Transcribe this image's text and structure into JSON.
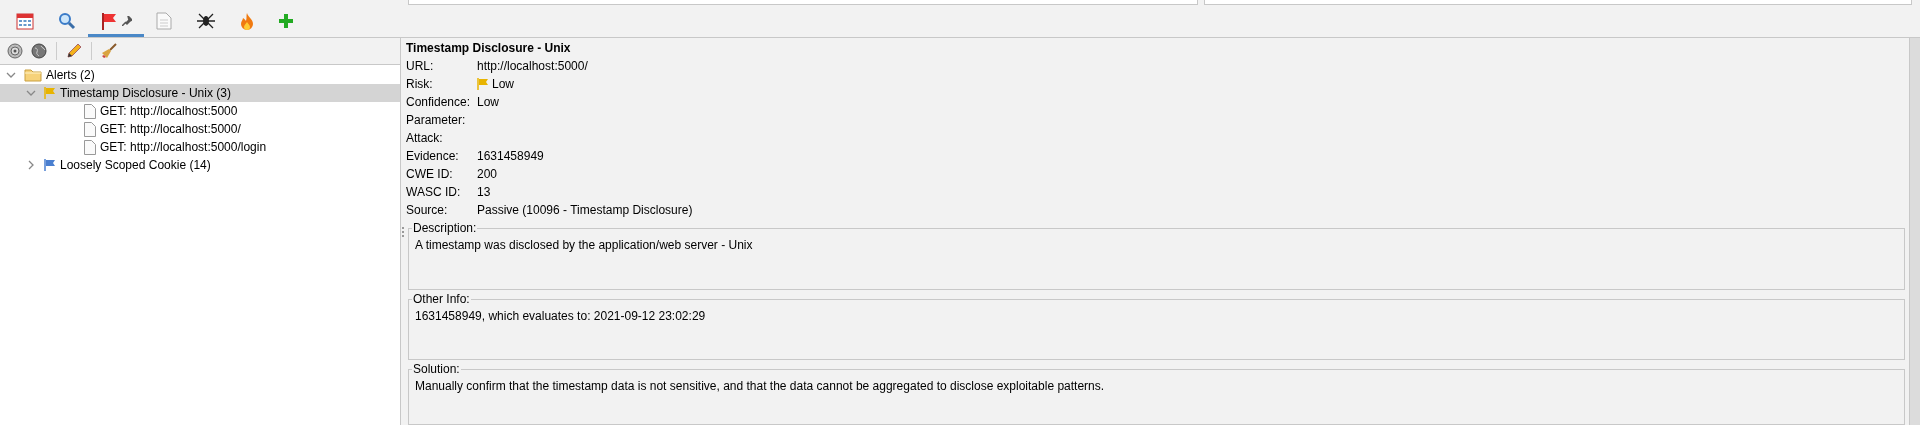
{
  "tabs": [
    {
      "kind": "calendar",
      "selected": false
    },
    {
      "kind": "search",
      "selected": false
    },
    {
      "kind": "alerts",
      "selected": true
    },
    {
      "kind": "document",
      "selected": false
    },
    {
      "kind": "spider",
      "selected": false
    },
    {
      "kind": "fire",
      "selected": false
    },
    {
      "kind": "add",
      "selected": false
    }
  ],
  "toolbar": [
    {
      "kind": "target"
    },
    {
      "kind": "globe"
    },
    {
      "kind": "pencil"
    },
    {
      "kind": "broom"
    }
  ],
  "tree": [
    {
      "kind": "folder",
      "label": "Alerts (2)",
      "expanded": true,
      "selected": false,
      "children": [
        {
          "kind": "alert",
          "label": "Timestamp Disclosure - Unix (3)",
          "color": "#e8b400",
          "expanded": true,
          "selected": true,
          "children": [
            {
              "kind": "page",
              "label": "GET: http://localhost:5000",
              "selected": false
            },
            {
              "kind": "page",
              "label": "GET: http://localhost:5000/",
              "selected": false
            },
            {
              "kind": "page",
              "label": "GET: http://localhost:5000/login",
              "selected": false
            }
          ]
        },
        {
          "kind": "alert",
          "label": "Loosely Scoped Cookie (14)",
          "color": "#4a7fd0",
          "expanded": false,
          "selected": false
        }
      ]
    }
  ],
  "details": {
    "title": "Timestamp Disclosure - Unix",
    "fields": [
      {
        "label": "URL:",
        "value": "http://localhost:5000/"
      },
      {
        "label": "Risk:",
        "value": "Low",
        "color": "#e8b400"
      },
      {
        "label": "Confidence:",
        "value": "Low"
      },
      {
        "label": "Parameter:"
      },
      {
        "label": "Attack:"
      },
      {
        "label": "Evidence:",
        "value": "1631458949"
      },
      {
        "label": "CWE ID:",
        "value": "200"
      },
      {
        "label": "WASC ID:",
        "value": "13"
      },
      {
        "label": "Source:",
        "value": "Passive (10096 - Timestamp Disclosure)"
      }
    ],
    "sections": [
      {
        "legend": "Description:",
        "text": "A timestamp was disclosed by the application/web server - Unix"
      },
      {
        "legend": "Other Info:",
        "text": "1631458949, which evaluates to: 2021-09-12 23:02:29"
      },
      {
        "legend": "Solution:",
        "text": "Manually confirm that the timestamp data is not sensitive, and that the data cannot be aggregated to disclose exploitable patterns."
      }
    ]
  }
}
